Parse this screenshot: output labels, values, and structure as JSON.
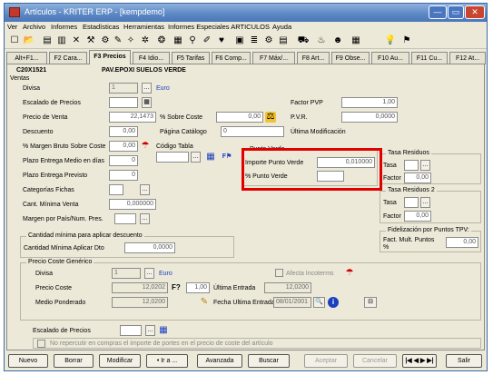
{
  "window": {
    "title": "Artículos - KRITER ERP - [kempdemo]",
    "minimize": "—",
    "maximize": "▭",
    "close": "✕"
  },
  "menu": [
    "Ver",
    "Archivo",
    "Informes",
    "Estadísticas",
    "Herramientas",
    "Informes Especiales ARTICULOS",
    "Ayuda"
  ],
  "toolbar": [
    {
      "icon": "checkbox-icon",
      "glyph": "☐"
    },
    {
      "icon": "folder-open-icon",
      "glyph": "📂"
    },
    {
      "icon": "save-icon",
      "glyph": "▤"
    },
    {
      "icon": "print-icon",
      "glyph": "▥"
    },
    {
      "icon": "delete-icon",
      "glyph": "✕"
    },
    {
      "icon": "tool-icon",
      "glyph": "⚒"
    },
    {
      "icon": "tool2-icon",
      "glyph": "⚙"
    },
    {
      "icon": "pencil-icon",
      "glyph": "✎"
    },
    {
      "icon": "magic-icon",
      "glyph": "✧"
    },
    {
      "icon": "grid-icon",
      "glyph": "✲"
    },
    {
      "icon": "tag-icon",
      "glyph": "❂"
    },
    {
      "icon": "calc-icon",
      "glyph": "▦"
    },
    {
      "icon": "pin-icon",
      "glyph": "⚲"
    },
    {
      "icon": "brush-icon",
      "glyph": "✐"
    },
    {
      "icon": "heart-icon",
      "glyph": "♥"
    },
    {
      "icon": "box-icon",
      "glyph": "▣"
    },
    {
      "icon": "stack-icon",
      "glyph": "≣"
    },
    {
      "icon": "gear-icon",
      "glyph": "⚙"
    },
    {
      "icon": "report-icon",
      "glyph": "▤"
    },
    {
      "icon": "cart-icon",
      "glyph": "⛟"
    },
    {
      "icon": "flask-icon",
      "glyph": "♨"
    },
    {
      "icon": "people-icon",
      "glyph": "☻"
    },
    {
      "icon": "calendar-icon",
      "glyph": "▦"
    },
    {
      "icon": "bulb-icon",
      "glyph": "💡"
    },
    {
      "icon": "exit-icon",
      "glyph": "⚑"
    }
  ],
  "tabs": [
    "Alt+F1...",
    "F2 Cara...",
    "F3 Precios",
    "F4 Idio...",
    "F5 Tarifas",
    "F6 Comp...",
    "F7 Máx/...",
    "F8 Art...",
    "F9 Obse...",
    "F10 Au...",
    "F11 Cu...",
    "F12 At..."
  ],
  "active_tab_index": 2,
  "header": {
    "code": "C20X1521",
    "description": "PAV.EPOXI SUELOS VERDE"
  },
  "ventas": {
    "group": "Ventas",
    "divisa_label": "Divisa",
    "divisa_value": "1",
    "divisa_name": "Euro",
    "escalado_label": "Escalado de Precios",
    "precio_venta_label": "Precio de Venta",
    "precio_venta_value": "22,1473",
    "sobre_coste_label": "% Sobre Coste",
    "sobre_coste_value": "0,00",
    "descuento_label": "Descuento",
    "descuento_value": "0,00",
    "pagina_catalogo_label": "Página Catálogo",
    "pagina_catalogo_value": "0",
    "margen_bruto_label": "% Margen Bruto Sobre Coste",
    "margen_bruto_value": "0,00",
    "plazo_medio_label": "Plazo Entrega Medio en días",
    "plazo_medio_value": "0",
    "plazo_previsto_label": "Plazo Entrega Previsto",
    "plazo_previsto_value": "0",
    "categorias_label": "Categorías Fichas",
    "cant_minima_label": "Cant. Mínima Venta",
    "cant_minima_value": "0,000000",
    "margen_pais_label": "Margen por País/Num. Pres.",
    "codigo_tabla_label": "Código Tabla",
    "factor_pvp_label": "Factor PVP",
    "factor_pvp_value": "1,00",
    "pvr_label": "P.V.R.",
    "pvr_value": "0,0000",
    "ultima_modificacion_label": "Última Modificación"
  },
  "punto_verde": {
    "group": "Punto Verde",
    "importe_label": "Importe Punto Verde",
    "importe_value": "0,010000",
    "porc_label": "% Punto Verde",
    "porc_value": ""
  },
  "tasa_residuos": {
    "group": "Tasa Residuos",
    "tasa_label": "Tasa",
    "factor_label": "Factor",
    "factor_value": "0,00"
  },
  "tasa_residuos2": {
    "group": "Tasa Residuos 2",
    "tasa_label": "Tasa",
    "factor_label": "Factor",
    "factor_value": "0,00"
  },
  "fidelizacion": {
    "group": "Fidelización por Puntos TPV:",
    "label": "Fact. Mult. Puntos %",
    "value": "0,00"
  },
  "cant_aplicar": {
    "group": "Cantidad mínima para aplicar descuento",
    "label": "Cantidad Mínima Aplicar Dto",
    "value": "0,0000"
  },
  "precio_coste": {
    "group": "Precio Coste Genérico",
    "divisa_label": "Divisa",
    "divisa_value": "1",
    "divisa_name": "Euro",
    "afecta_label": "Afecta Incoterms",
    "precio_coste_label": "Precio Coste",
    "precio_coste_value": "12,0202",
    "f_label": "F?",
    "f_value": "1,00",
    "ultima_entrada_label": "Última Entrada",
    "ultima_entrada_value": "12,0200",
    "medio_label": "Medio Ponderado",
    "medio_value": "12,0200",
    "fecha_label": "Fecha Ultima Entrada",
    "fecha_value": "08/01/2001"
  },
  "escalado2_label": "Escalado de Precios",
  "no_repercutir_label": "No repercutir en compras el importe de portes en el precio de coste del artículo",
  "buttons": {
    "nuevo": "Nuevo",
    "borrar": "Borrar",
    "modificar": "Modificar",
    "ira": "• Ir a ...",
    "avanzada": "Avanzada",
    "buscar": "Buscar",
    "aceptar": "Aceptar",
    "cancelar": "Cancelar",
    "nav": "|◀ ◀ ▶ ▶|",
    "salir": "Salir"
  }
}
